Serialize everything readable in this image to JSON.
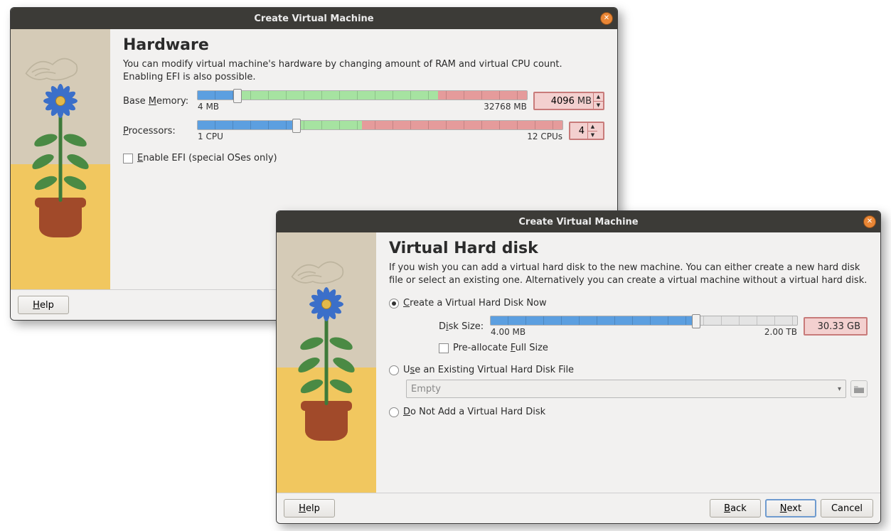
{
  "win1": {
    "title": "Create Virtual Machine",
    "heading": "Hardware",
    "description": "You can modify virtual machine's hardware by changing amount of RAM and virtual CPU count. Enabling EFI is also possible.",
    "memory": {
      "label_pre": "Base ",
      "label_u": "M",
      "label_post": "emory:",
      "value": "4096",
      "unit": "MB",
      "min": "4 MB",
      "max": "32768 MB"
    },
    "processors": {
      "label_u": "P",
      "label_post": "rocessors:",
      "value": "4",
      "min": "1 CPU",
      "max": "12 CPUs"
    },
    "efi_pre": "",
    "efi_u": "E",
    "efi_post": "nable EFI (special OSes only)",
    "help_u": "H",
    "help_post": "elp"
  },
  "win2": {
    "title": "Create Virtual Machine",
    "heading": "Virtual Hard disk",
    "description": "If you wish you can add a virtual hard disk to the new machine. You can either create a new hard disk file or select an existing one. Alternatively you can create a virtual machine without a virtual hard disk.",
    "opt_create_u": "C",
    "opt_create_post": "reate a Virtual Hard Disk Now",
    "disk_label_pre": "D",
    "disk_label_u": "i",
    "disk_label_post": "sk Size:",
    "disk_value": "30.33 GB",
    "disk_min": "4.00 MB",
    "disk_max": "2.00 TB",
    "prealloc_pre": "Pre-allocate ",
    "prealloc_u": "F",
    "prealloc_post": "ull Size",
    "opt_use_pre": "U",
    "opt_use_u": "s",
    "opt_use_post": "e an Existing Virtual Hard Disk File",
    "combo_value": "Empty",
    "opt_none_u": "D",
    "opt_none_post": "o Not Add a Virtual Hard Disk",
    "help_u": "H",
    "help_post": "elp",
    "back_u": "B",
    "back_post": "ack",
    "next_u": "N",
    "next_post": "ext",
    "cancel": "Cancel"
  }
}
